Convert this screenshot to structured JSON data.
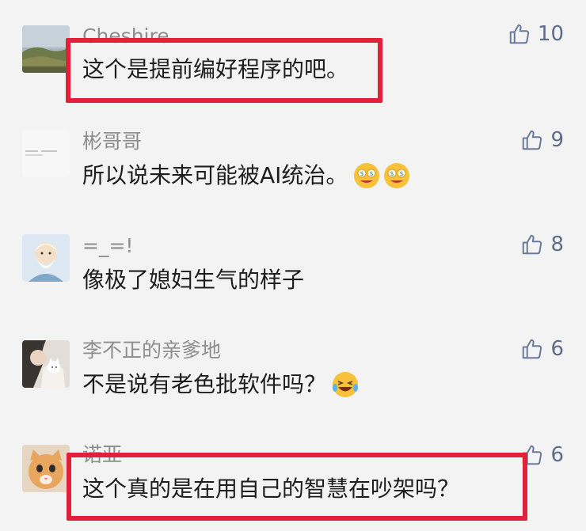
{
  "comments": [
    {
      "username": "Cheshire",
      "text": "这个是提前编好程序的吧。",
      "likes": "10",
      "avatar": "landscape-avatar",
      "emoji": []
    },
    {
      "username": "彬哥哥",
      "text": "所以说未来可能被AI统治。",
      "likes": "9",
      "avatar": "document-avatar",
      "emoji": [
        "money-face-emoji",
        "money-face-emoji"
      ]
    },
    {
      "username": "=_=!",
      "text": "像极了媳妇生气的样子",
      "likes": "8",
      "avatar": "cartoon-sage-avatar",
      "emoji": []
    },
    {
      "username": "李不正的亲爹地",
      "text": "不是说有老色批软件吗？",
      "likes": "6",
      "avatar": "cat-and-person-avatar",
      "emoji": [
        "laughing-tears-emoji"
      ]
    },
    {
      "username": "诺亚",
      "text": "这个真的是在用自己的智慧在吵架吗？",
      "likes": "6",
      "avatar": "orange-cat-avatar",
      "emoji": []
    }
  ],
  "colors": {
    "highlight": "#e3203a",
    "like_icon": "#6b7a99",
    "username": "#8d8d8d",
    "text": "#1d1d1d",
    "background": "#f3f3f3"
  }
}
